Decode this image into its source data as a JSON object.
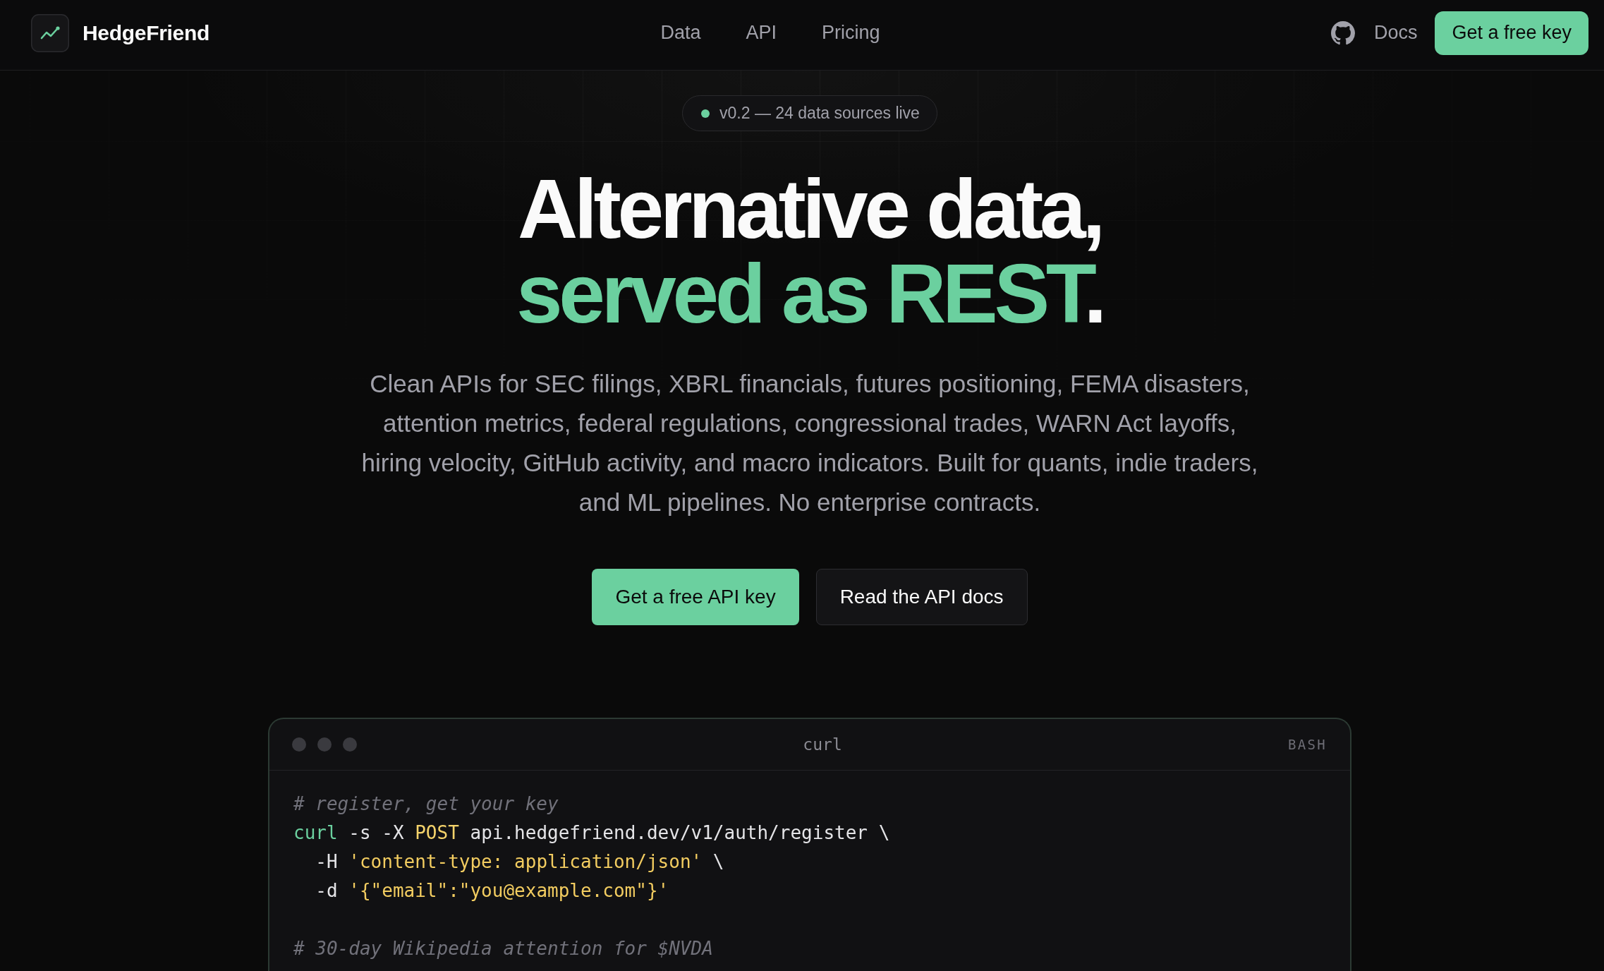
{
  "header": {
    "brand": "HedgeFriend",
    "nav": [
      "Data",
      "API",
      "Pricing"
    ],
    "docs_link": "Docs",
    "cta_button": "Get a free key"
  },
  "hero": {
    "badge": "v0.2 — 24 data sources live",
    "heading": {
      "line_1": "Alternative data,",
      "line_2_accent": "served as REST",
      "line_2_end": "."
    },
    "description": "Clean APIs for SEC filings, XBRL financials, futures positioning, FEMA disasters, attention metrics, federal regulations, congressional trades, WARN Act layoffs, hiring velocity, GitHub activity, and macro indicators. Built for quants, indie traders, and ML pipelines. No enterprise contracts.",
    "buttons": [
      {
        "label": "Get a free API key",
        "kind": "primary"
      },
      {
        "label": "Read the API docs",
        "kind": "secondary"
      }
    ]
  },
  "code_window": {
    "title": "curl",
    "language": "BASH",
    "blocks": [
      {
        "lines": [
          [
            {
              "kind": "comment",
              "text": "# register, get your key"
            }
          ],
          [
            {
              "kind": "command",
              "text": "curl"
            },
            {
              "kind": "plain",
              "text": " -s -X "
            },
            {
              "kind": "keyword",
              "text": "POST"
            },
            {
              "kind": "plain",
              "text": " api.hedgefriend.dev/v1/auth/register \\"
            }
          ],
          [
            {
              "kind": "plain",
              "text": "  -H "
            },
            {
              "kind": "string",
              "text": "'content-type: application/json'"
            },
            {
              "kind": "plain",
              "text": " \\"
            }
          ],
          [
            {
              "kind": "plain",
              "text": "  -d "
            },
            {
              "kind": "string",
              "text": "'{\"email\":\"you@example.com\"}'"
            }
          ]
        ]
      },
      {
        "lines": [
          [
            {
              "kind": "comment",
              "text": "# 30-day Wikipedia attention for $NVDA"
            }
          ]
        ]
      }
    ]
  }
}
